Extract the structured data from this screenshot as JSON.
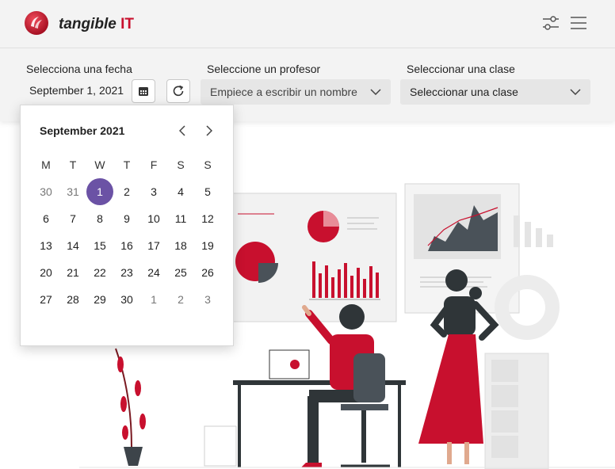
{
  "brand": {
    "name": "tangible",
    "suffix": "IT"
  },
  "header": {
    "filter_icon": "sliders-icon",
    "menu_icon": "hamburger-menu-icon"
  },
  "filters": {
    "date": {
      "label": "Selecciona una fecha",
      "value": "September 1, 2021"
    },
    "teacher": {
      "label": "Seleccione un profesor",
      "placeholder": "Empiece a escribir un nombre"
    },
    "class": {
      "label": "Seleccionar una clase",
      "value": "Seleccionar una clase"
    }
  },
  "calendar": {
    "month_label": "September 2021",
    "weekdays": [
      "M",
      "T",
      "W",
      "T",
      "F",
      "S",
      "S"
    ],
    "weeks": [
      [
        "30",
        "31",
        "1",
        "2",
        "3",
        "4",
        "5"
      ],
      [
        "6",
        "7",
        "8",
        "9",
        "10",
        "11",
        "12"
      ],
      [
        "13",
        "14",
        "15",
        "16",
        "17",
        "18",
        "19"
      ],
      [
        "20",
        "21",
        "22",
        "23",
        "24",
        "25",
        "26"
      ],
      [
        "27",
        "28",
        "29",
        "30",
        "1",
        "2",
        "3"
      ]
    ],
    "selected": "1"
  },
  "colors": {
    "accent": "#c8102e",
    "selected": "#6b52a5",
    "bar": "#f3f3f3"
  }
}
